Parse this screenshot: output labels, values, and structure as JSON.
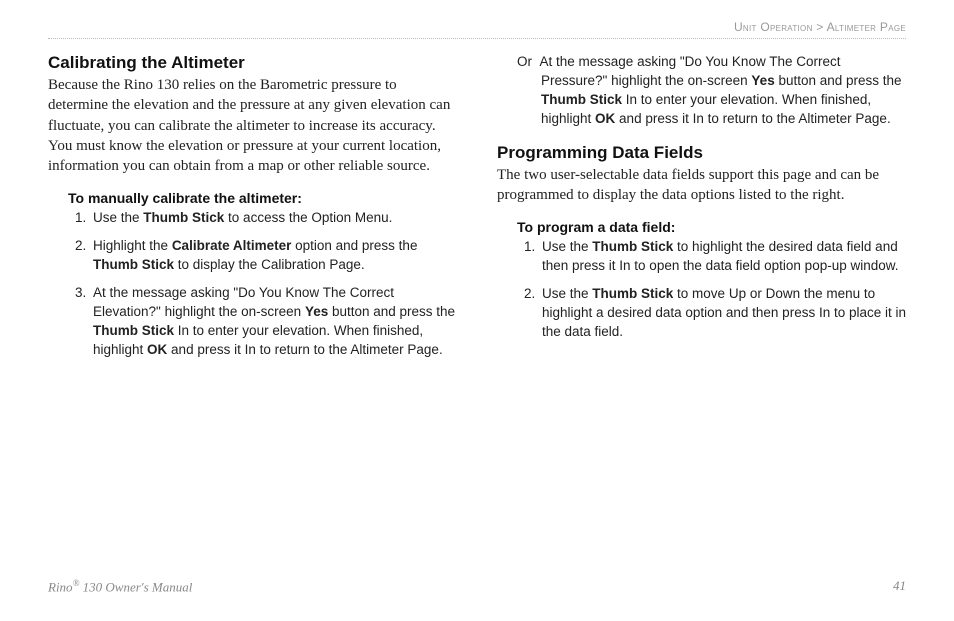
{
  "breadcrumb": {
    "section": "Unit Operation",
    "sep": " > ",
    "page": "Altimeter Page"
  },
  "left": {
    "h1": "Calibrating the Altimeter",
    "p1": "Because the Rino 130 relies on the Barometric pressure to determine the elevation and the pressure at any given elevation can fluctuate, you can calibrate the altimeter to increase its accuracy. You must know the elevation or pressure at your current location, information you can obtain from a map or other reliable source.",
    "sub": "To manually calibrate the altimeter:",
    "s1a": "Use the ",
    "s1b": "Thumb Stick",
    "s1c": " to access the Option Menu.",
    "s2a": "Highlight the ",
    "s2b": "Calibrate Altimeter",
    "s2c": " option and press the ",
    "s2d": "Thumb Stick",
    "s2e": " to display the Calibration Page.",
    "s3a": "At the message asking \"Do You Know The Correct Elevation?\" highlight the on-screen ",
    "s3b": "Yes",
    "s3c": " button and press the ",
    "s3d": "Thumb Stick",
    "s3e": " In to enter your elevation. When finished, highlight ",
    "s3f": "OK",
    "s3g": " and press it In to return to the Altimeter Page."
  },
  "right": {
    "orLabel": "Or",
    "or_a": "At the message asking \"Do You Know The Correct Pressure?\" highlight the on-screen ",
    "or_b": "Yes",
    "or_c": " button and press the ",
    "or_d": "Thumb Stick",
    "or_e": " In to enter your elevation. When finished, highlight ",
    "or_f": "OK",
    "or_g": " and press it In to return to the Altimeter Page.",
    "h2": "Programming Data Fields",
    "p2": "The two user-selectable data fields support this page and can be programmed to display the data options listed to the right.",
    "sub": "To program a data field:",
    "s1a": "Use the ",
    "s1b": "Thumb Stick",
    "s1c": " to highlight the desired data field and then press it In to open the data field option pop-up window.",
    "s2a": "Use the ",
    "s2b": "Thumb Stick",
    "s2c": " to move Up or Down the menu to highlight a desired data option and then press In to place it in the data field."
  },
  "footer": {
    "left_a": "Rino",
    "left_sup": "®",
    "left_b": " 130 Owner's Manual",
    "pageNum": "41"
  }
}
